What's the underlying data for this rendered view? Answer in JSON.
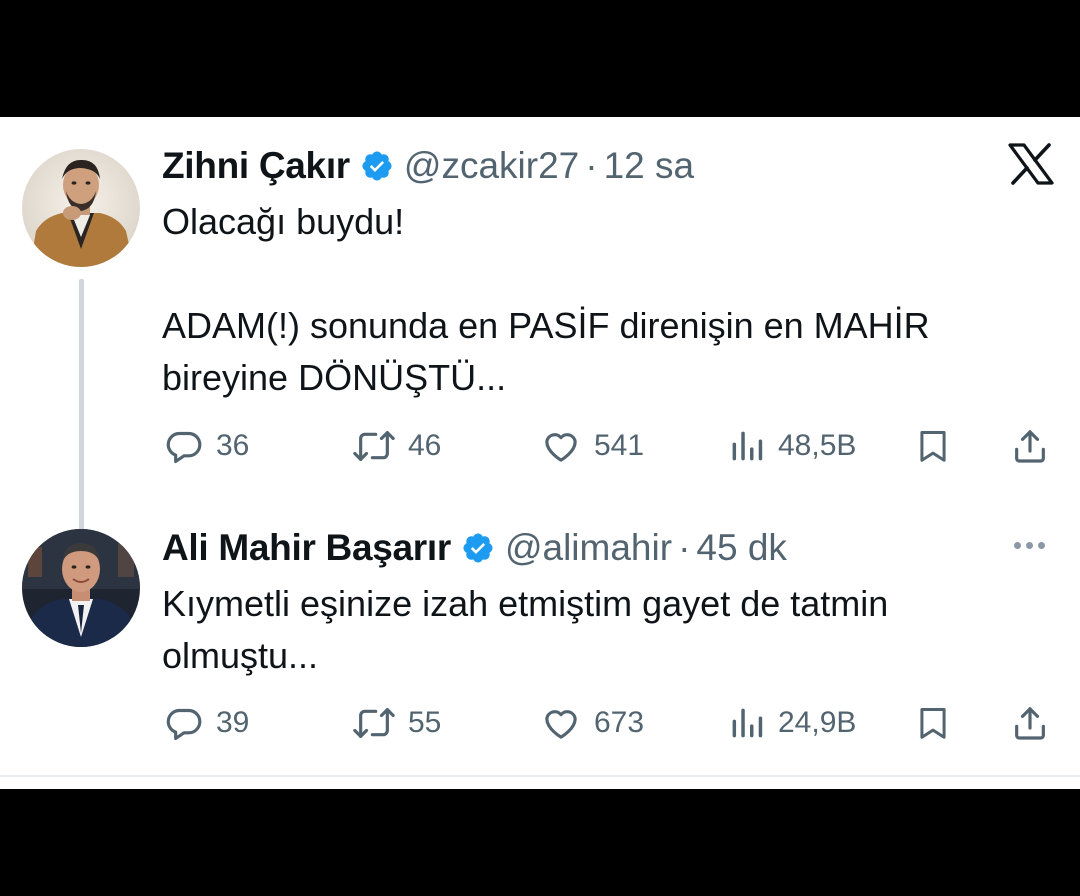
{
  "tweets": [
    {
      "name": "Zihni Çakır",
      "handle": "@zcakir27",
      "separator": "·",
      "time": "12 sa",
      "text_lines": [
        "Olacağı buydu!",
        "",
        "ADAM(!) sonunda en PASİF direnişin en MAHİR",
        "bireyine DÖNÜŞTÜ..."
      ],
      "stats": {
        "replies": "36",
        "reposts": "46",
        "likes": "541",
        "views": "48,5B"
      }
    },
    {
      "name": "Ali Mahir Başarır",
      "handle": "@alimahir",
      "separator": "·",
      "time": "45 dk",
      "text_lines": [
        "Kıymetli eşinize izah etmiştim gayet de tatmin",
        "olmuştu..."
      ],
      "stats": {
        "replies": "39",
        "reposts": "55",
        "likes": "673",
        "views": "24,9B"
      }
    }
  ],
  "icons": {
    "brand": "x-logo-icon",
    "verified": "verified-badge-icon",
    "reply": "reply-icon",
    "repost": "repost-icon",
    "like": "heart-icon",
    "views": "views-icon",
    "bookmark": "bookmark-icon",
    "share": "share-icon",
    "more": "more-icon"
  },
  "colors": {
    "background": "#000000",
    "card": "#ffffff",
    "text": "#0f1419",
    "secondary": "#536471",
    "verified": "#1d9bf0",
    "thread_line": "#d0d6dc"
  }
}
